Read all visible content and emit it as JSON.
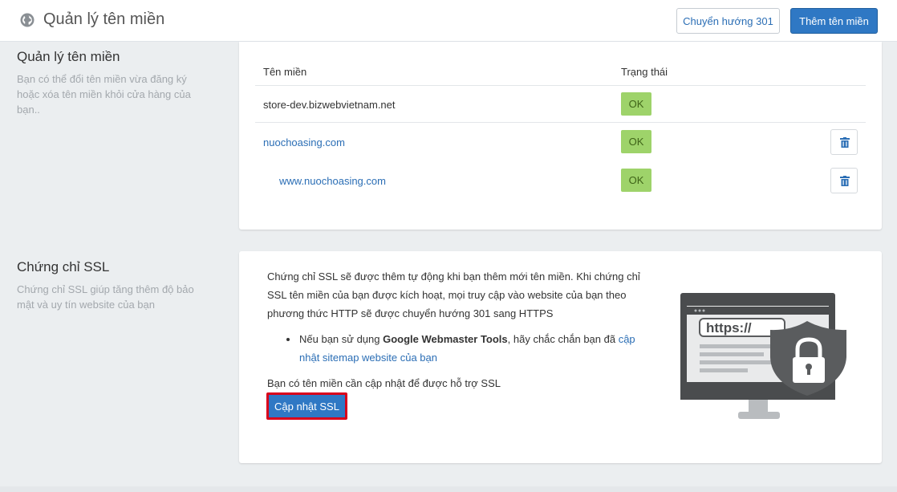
{
  "header": {
    "title": "Quản lý tên miền",
    "redirect_button": "Chuyển hướng 301",
    "add_button": "Thêm tên miền"
  },
  "domains_section": {
    "title": "Quản lý tên miền",
    "description": "Bạn có thể đổi tên miền vừa đăng ký hoặc xóa tên miền khỏi cửa hàng của bạn..",
    "columns": [
      "Tên miền",
      "Trạng thái"
    ],
    "rows": [
      {
        "domain": "store-dev.bizwebvietnam.net",
        "status": "OK",
        "deletable": false
      },
      {
        "domain": "nuochoasing.com",
        "status": "OK",
        "deletable": true
      },
      {
        "domain": "www.nuochoasing.com",
        "status": "OK",
        "deletable": true
      }
    ]
  },
  "ssl_section": {
    "title": "Chứng chỉ SSL",
    "description": "Chứng chỉ SSL giúp tăng thêm độ bảo mật và uy tín website của bạn",
    "intro": "Chứng chỉ SSL sẽ được thêm tự động khi bạn thêm mới tên miền. Khi chứng chỉ SSL tên miền của bạn được kích hoạt, mọi truy cập vào website của bạn theo phương thức HTTP sẽ được chuyển hướng 301 sang HTTPS",
    "bullet_prefix": "Nếu bạn sử dụng ",
    "bullet_bold": "Google Webmaster Tools",
    "bullet_middle": ", hãy chắc chắn bạn đã ",
    "bullet_link": "cập nhật sitemap website của bạn",
    "note": "Bạn có tên miền cần cập nhật để được hỗ trợ SSL",
    "update_button": "Cập nhật SSL",
    "illustration_text": "https://"
  },
  "colors": {
    "primary": "#2f78c4",
    "link": "#2b6eb5",
    "ok_badge": "#9ed36a",
    "highlight": "#d9001b"
  },
  "icons": [
    "globe-icon",
    "trash-icon",
    "lock-icon",
    "shield-icon"
  ]
}
